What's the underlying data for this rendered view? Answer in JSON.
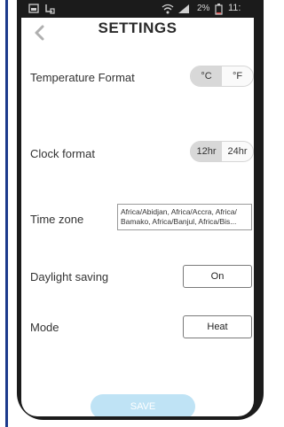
{
  "status_bar": {
    "battery_percent": "2%",
    "time": "11:"
  },
  "header": {
    "title": "SETTINGS"
  },
  "settings": {
    "temperature": {
      "label": "Temperature Format",
      "options": [
        "°C",
        "°F"
      ],
      "selected": "°C"
    },
    "clock": {
      "label": "Clock format",
      "options": [
        "12hr",
        "24hr"
      ],
      "selected": "12hr"
    },
    "timezone": {
      "label": "Time zone",
      "line1": "Africa/Abidjan, Africa/Accra, Africa/",
      "line2": "Bamako, Africa/Banjul, Africa/Bis..."
    },
    "daylight": {
      "label": "Daylight saving",
      "value": "On"
    },
    "mode": {
      "label": "Mode",
      "value": "Heat"
    }
  },
  "save_label": "SAVE",
  "colors": {
    "save_button": "#bfe3f5",
    "phone_frame": "#1b1b1b",
    "left_rule": "#1c3a8c"
  }
}
